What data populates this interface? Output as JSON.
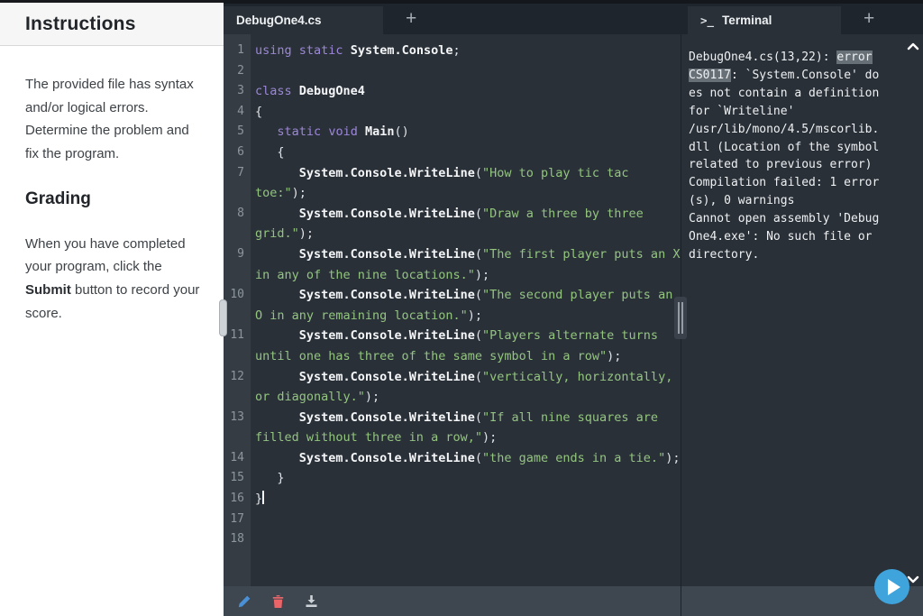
{
  "instructions_panel": {
    "title": "Instructions",
    "paragraph1": "The provided file has syntax and/or logical errors. Determine the problem and fix the program.",
    "grading_heading": "Grading",
    "paragraph2_parts": {
      "pre": "When you have completed your program, click the ",
      "bold": "Submit",
      "post": " button to record your score."
    }
  },
  "editor": {
    "tab_label": "DebugOne4.cs",
    "new_tab_label": "+",
    "lines": [
      {
        "n": 1,
        "tokens": [
          {
            "t": "kw",
            "s": "using"
          },
          {
            "t": "p",
            "s": " "
          },
          {
            "t": "kw",
            "s": "static"
          },
          {
            "t": "p",
            "s": " "
          },
          {
            "t": "id",
            "s": "System.Console"
          },
          {
            "t": "p",
            "s": ";"
          }
        ]
      },
      {
        "n": 2,
        "tokens": []
      },
      {
        "n": 3,
        "tokens": [
          {
            "t": "kw",
            "s": "class"
          },
          {
            "t": "p",
            "s": " "
          },
          {
            "t": "id",
            "s": "DebugOne4"
          }
        ]
      },
      {
        "n": 4,
        "tokens": [
          {
            "t": "p",
            "s": "{"
          }
        ]
      },
      {
        "n": 5,
        "tokens": [
          {
            "t": "p",
            "s": "   "
          },
          {
            "t": "kw",
            "s": "static"
          },
          {
            "t": "p",
            "s": " "
          },
          {
            "t": "kw",
            "s": "void"
          },
          {
            "t": "p",
            "s": " "
          },
          {
            "t": "id",
            "s": "Main"
          },
          {
            "t": "p",
            "s": "()"
          }
        ]
      },
      {
        "n": 6,
        "tokens": [
          {
            "t": "p",
            "s": "   {"
          }
        ]
      },
      {
        "n": 7,
        "tokens": [
          {
            "t": "p",
            "s": "      "
          },
          {
            "t": "id",
            "s": "System.Console.WriteLine"
          },
          {
            "t": "p",
            "s": "("
          },
          {
            "t": "str",
            "s": "\"How to play tic tac toe:\""
          },
          {
            "t": "p",
            "s": ");"
          }
        ]
      },
      {
        "n": 8,
        "tokens": [
          {
            "t": "p",
            "s": "      "
          },
          {
            "t": "id",
            "s": "System.Console.WriteLine"
          },
          {
            "t": "p",
            "s": "("
          },
          {
            "t": "str",
            "s": "\"Draw a three by three grid.\""
          },
          {
            "t": "p",
            "s": ");"
          }
        ]
      },
      {
        "n": 9,
        "tokens": [
          {
            "t": "p",
            "s": "      "
          },
          {
            "t": "id",
            "s": "System.Console.WriteLine"
          },
          {
            "t": "p",
            "s": "("
          },
          {
            "t": "str",
            "s": "\"The first player puts an X in any of the nine locations.\""
          },
          {
            "t": "p",
            "s": ");"
          }
        ]
      },
      {
        "n": 10,
        "tokens": [
          {
            "t": "p",
            "s": "      "
          },
          {
            "t": "id",
            "s": "System.Console.WriteLine"
          },
          {
            "t": "p",
            "s": "("
          },
          {
            "t": "str",
            "s": "\"The second player puts an O in any remaining location.\""
          },
          {
            "t": "p",
            "s": ");"
          }
        ]
      },
      {
        "n": 11,
        "tokens": [
          {
            "t": "p",
            "s": "      "
          },
          {
            "t": "id",
            "s": "System.Console.WriteLine"
          },
          {
            "t": "p",
            "s": "("
          },
          {
            "t": "str",
            "s": "\"Players alternate turns until one has three of the same symbol in a row\""
          },
          {
            "t": "p",
            "s": ");"
          }
        ]
      },
      {
        "n": 12,
        "tokens": [
          {
            "t": "p",
            "s": "      "
          },
          {
            "t": "id",
            "s": "System.Console.WriteLine"
          },
          {
            "t": "p",
            "s": "("
          },
          {
            "t": "str",
            "s": "\"vertically, horizontally, or diagonally.\""
          },
          {
            "t": "p",
            "s": ");"
          }
        ]
      },
      {
        "n": 13,
        "tokens": [
          {
            "t": "p",
            "s": "      "
          },
          {
            "t": "id",
            "s": "System.Console.Writeline"
          },
          {
            "t": "p",
            "s": "("
          },
          {
            "t": "str",
            "s": "\"If all nine squares are filled without three in a row,\""
          },
          {
            "t": "p",
            "s": ");"
          }
        ]
      },
      {
        "n": 14,
        "tokens": [
          {
            "t": "p",
            "s": "      "
          },
          {
            "t": "id",
            "s": "System.Console.WriteLine"
          },
          {
            "t": "p",
            "s": "("
          },
          {
            "t": "str",
            "s": "\"the game ends in a tie.\""
          },
          {
            "t": "p",
            "s": ");"
          }
        ]
      },
      {
        "n": 15,
        "tokens": [
          {
            "t": "p",
            "s": "   }"
          }
        ]
      },
      {
        "n": 16,
        "tokens": [
          {
            "t": "p",
            "s": "}"
          }
        ],
        "cursor": true
      },
      {
        "n": 17,
        "tokens": []
      },
      {
        "n": 18,
        "tokens": []
      }
    ]
  },
  "terminal": {
    "tab_label": "Terminal",
    "tab_icon": ">_",
    "new_tab_label": "+",
    "lines": [
      [
        {
          "s": "DebugOne4.cs(13,22): "
        },
        {
          "s": "error",
          "hl": true
        },
        {
          "s": " "
        },
        {
          "s": "CS0117",
          "hl": true
        },
        {
          "s": ": `System.Console' does not contain a definition for `Writeline'"
        }
      ],
      [
        {
          "s": "/usr/lib/mono/4.5/mscorlib.dll (Location of the symbol related to previous error)"
        }
      ],
      [
        {
          "s": "Compilation failed: 1 error(s), 0 warnings"
        }
      ],
      [
        {
          "s": "Cannot open assembly 'DebugOne4.exe': No such file or directory."
        }
      ]
    ]
  },
  "toolbar": {
    "icons": [
      "edit-pencil",
      "delete-trash",
      "download"
    ]
  },
  "colors": {
    "accent_play": "#3fa3dc",
    "pencil": "#4a90d5",
    "trash": "#ea6468",
    "download": "#ccd2d7",
    "keyword": "#9c87d9",
    "string": "#93c57f",
    "error_highlight": "#687077",
    "editor_bg": "#2a3038"
  }
}
